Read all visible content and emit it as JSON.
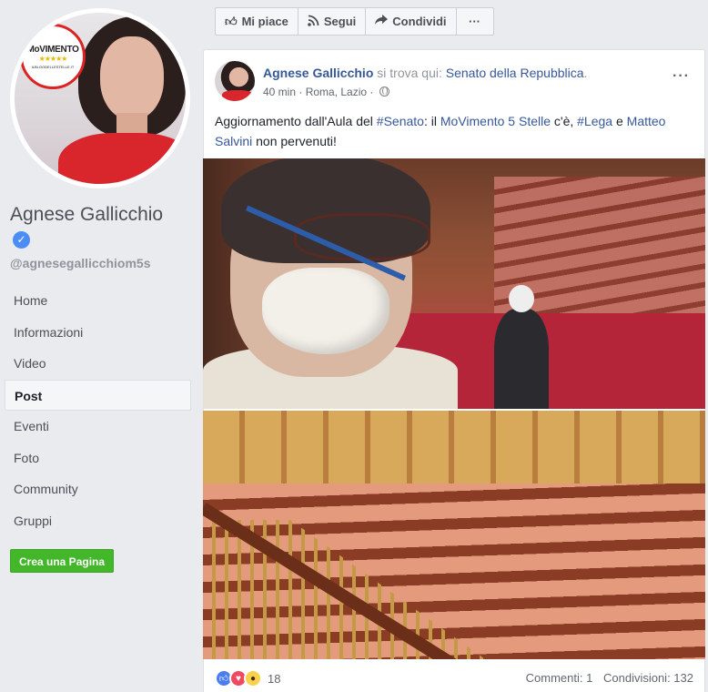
{
  "sidebar": {
    "page_name": "Agnese Gallicchio",
    "verified_glyph": "✓",
    "handle": "@agnesegallicchiom5s",
    "logo": {
      "word": "MoVIMENTO",
      "stars": "★★★★★",
      "url": "ILBLOGDELLESTELLE.IT"
    },
    "nav": [
      {
        "label": "Home"
      },
      {
        "label": "Informazioni"
      },
      {
        "label": "Video"
      },
      {
        "label": "Post"
      },
      {
        "label": "Eventi"
      },
      {
        "label": "Foto"
      },
      {
        "label": "Community"
      },
      {
        "label": "Gruppi"
      }
    ],
    "create_page": "Crea una Pagina"
  },
  "actionbar": {
    "like": "Mi piace",
    "follow": "Segui",
    "share": "Condividi",
    "more": "···"
  },
  "post": {
    "author": "Agnese Gallicchio",
    "checkin_text": "si trova qui:",
    "place": "Senato della Repubblica",
    "place_suffix": ".",
    "time": "40 min",
    "location": "Roma, Lazio",
    "more": "···",
    "text": {
      "part1": "Aggiornamento dall'Aula del ",
      "tag1": "#Senato",
      "part2": ": il ",
      "link1": "MoVimento 5 Stelle",
      "part3": " c'è, ",
      "tag2": "#Lega",
      "part4": " e ",
      "link2": "Matteo Salvini",
      "part5": " non pervenuti!"
    },
    "reactions_count": "18",
    "comments": "Commenti: 1",
    "shares": "Condivisioni: 132"
  },
  "colors": {
    "link": "#365899",
    "green_button": "#42b72a",
    "verified": "#4b8cf5",
    "background": "#e9ebee"
  },
  "icons": [
    "thumbs-up-icon",
    "rss-icon",
    "share-arrow-icon",
    "globe-icon",
    "more-icon",
    "verified-icon",
    "like-reaction-icon",
    "love-reaction-icon",
    "wow-reaction-icon"
  ]
}
